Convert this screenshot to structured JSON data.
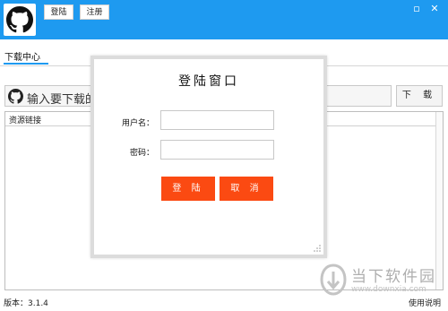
{
  "window": {
    "login_label": "登陆",
    "register_label": "注册",
    "minimize_icon": "▫",
    "close_icon": "✕"
  },
  "tabs": [
    {
      "label": "下载中心",
      "active": true
    }
  ],
  "search": {
    "placeholder_text": "输入要下载的",
    "download_label": "下 载"
  },
  "list": {
    "column_header": "资源链接"
  },
  "footer": {
    "version": "版本：3.1.4",
    "help": "使用说明"
  },
  "dialog": {
    "title": "登陆窗口",
    "username_label": "用户名：",
    "password_label": "密码：",
    "username_value": "",
    "password_value": "",
    "login_button": "登 陆",
    "cancel_button": "取 消"
  },
  "watermark": {
    "brand": "当下软件园",
    "url": "www.downxia.com"
  },
  "colors": {
    "titlebar": "#1e9af0",
    "accent_button": "#fb4a12"
  }
}
